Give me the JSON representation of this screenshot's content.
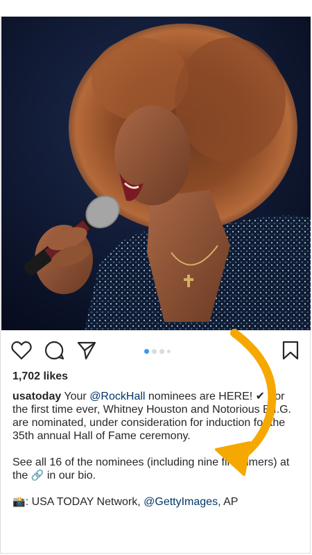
{
  "post": {
    "likes": "1,702 likes",
    "username": "usatoday",
    "caption": {
      "line1_pre": " Your ",
      "line1_mention": "@RockHall",
      "line1_post": " nominees are HERE! ✔",
      "body": "For the first time ever, Whitney Houston and Notorious B.I.G. are nominated, under consideration for induction for the 35th annual Hall of Fame ceremony.",
      "para2_pre": "See all 16 of the nominees (including nine first-timers) at the ",
      "para2_link_emoji": "🔗",
      "para2_post": " in our bio.",
      "credit_emoji": "📸",
      "credit_pre": ": USA TODAY Network, ",
      "credit_mention": "@GettyImages",
      "credit_post": ", AP"
    }
  },
  "carousel": {
    "count": 4,
    "active_index": 0
  },
  "icons": {
    "like": "heart-icon",
    "comment": "comment-bubble-icon",
    "share": "paper-plane-icon",
    "save": "bookmark-icon"
  },
  "colors": {
    "mention": "#003569",
    "active_dot": "#3897f0",
    "arrow": "#f5a800"
  }
}
